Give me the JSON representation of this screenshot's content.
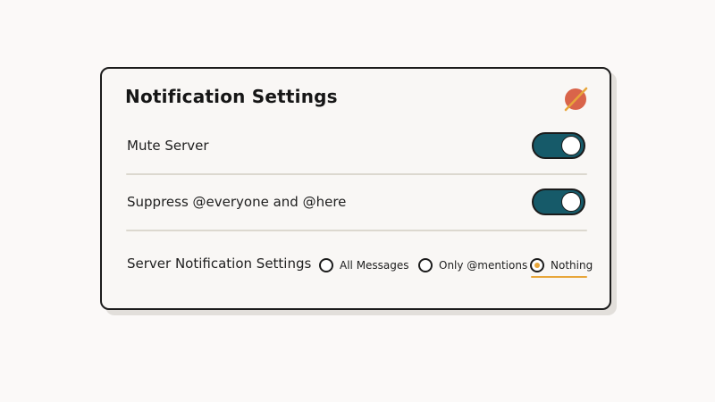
{
  "dialog": {
    "title": "Notification Settings",
    "close_icon": "close-icon",
    "accent_color": "#d9644a",
    "close_slash_color": "#e8a63a"
  },
  "settings": {
    "mute_server": {
      "label": "Mute Server",
      "enabled": true
    },
    "suppress_everyone": {
      "label": "Suppress @everyone and @here",
      "enabled": true
    },
    "server_notifications": {
      "label": "Server Notification Settings",
      "options": [
        "All Messages",
        "Only @mentions",
        "Nothing"
      ],
      "selected": "Nothing"
    }
  },
  "colors": {
    "toggle_on": "#165a69",
    "radio_selected": "#e8a63a",
    "divider": "#dcd8cf"
  }
}
